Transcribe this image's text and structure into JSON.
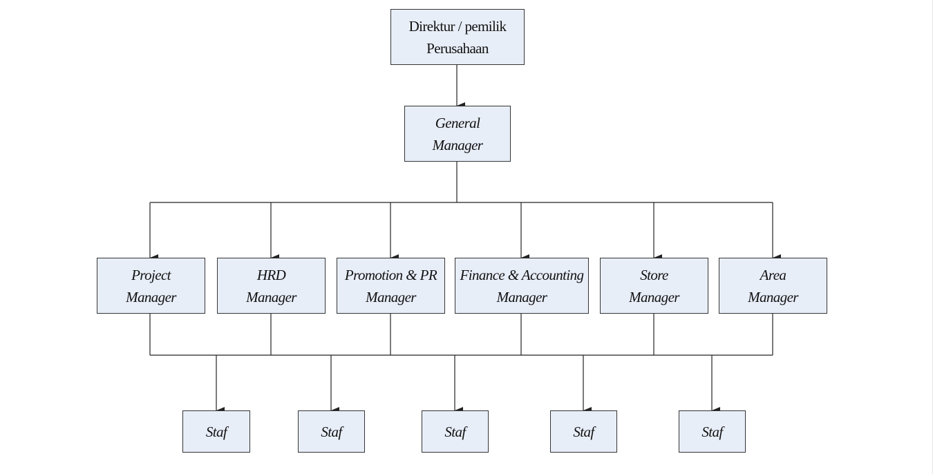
{
  "colors": {
    "box_fill": "#e8eef8",
    "line": "#222222"
  },
  "top": {
    "line1": "Direktur / pemilik",
    "line2": "Perusahaan"
  },
  "gm": {
    "line1": "General",
    "line2": "Manager"
  },
  "managers": [
    {
      "line1": "Project",
      "line2": "Manager"
    },
    {
      "line1": "HRD",
      "line2": "Manager"
    },
    {
      "line1": "Promotion & PR",
      "line2": "Manager"
    },
    {
      "line1": "Finance & Accounting",
      "line2": "Manager"
    },
    {
      "line1": "Store",
      "line2": "Manager"
    },
    {
      "line1": "Area",
      "line2": "Manager"
    }
  ],
  "staff": [
    {
      "label": "Staf"
    },
    {
      "label": "Staf"
    },
    {
      "label": "Staf"
    },
    {
      "label": "Staf"
    },
    {
      "label": "Staf"
    }
  ]
}
